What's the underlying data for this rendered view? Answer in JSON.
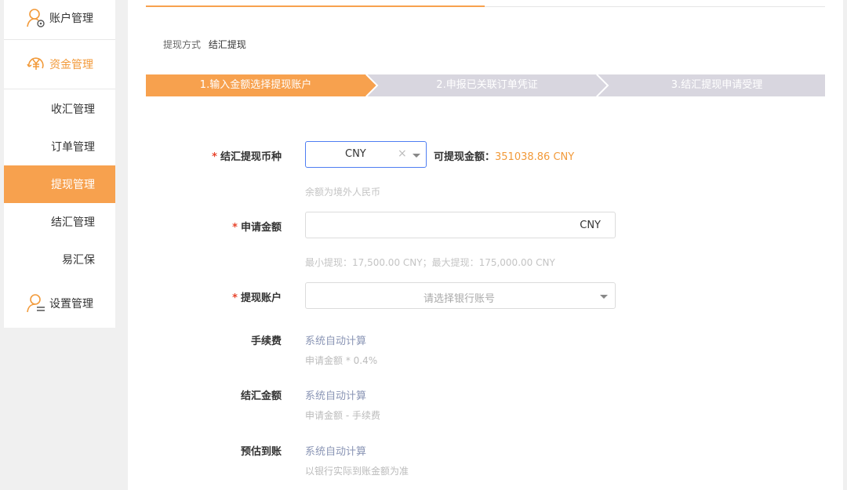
{
  "sidebar": {
    "account_label": "账户管理",
    "funds_label": "资金管理",
    "settings_label": "设置管理",
    "items": [
      {
        "label": "收汇管理"
      },
      {
        "label": "订单管理"
      },
      {
        "label": "提现管理"
      },
      {
        "label": "结汇管理"
      },
      {
        "label": "易汇保"
      }
    ],
    "active_index": 2
  },
  "breadcrumb": {
    "prefix": "提现方式",
    "current": "结汇提现"
  },
  "steps": [
    {
      "label": "1.输入金额选择提现账户",
      "state": "active"
    },
    {
      "label": "2.申报已关联订单凭证",
      "state": "pending"
    },
    {
      "label": "3.结汇提现申请受理",
      "state": "pending"
    }
  ],
  "form": {
    "currency": {
      "label": "结汇提现币种",
      "value": "CNY",
      "clear": "×",
      "available_label": "可提现金额：",
      "available_value": "351038.86 CNY",
      "hint": "余额为境外人民币"
    },
    "amount": {
      "label": "申请金额",
      "value": "",
      "suffix": "CNY",
      "hint": "最小提现：17,500.00 CNY；最大提现：175,000.00 CNY"
    },
    "account": {
      "label": "提现账户",
      "placeholder": "请选择银行账号"
    },
    "fee": {
      "label": "手续费",
      "value": "系统自动计算",
      "note": "申请金额 * 0.4%"
    },
    "settle": {
      "label": "结汇金额",
      "value": "系统自动计算",
      "note": "申请金额 - 手续费"
    },
    "estimate": {
      "label": "预估到账",
      "value": "系统自动计算",
      "note": "以银行实际到账金额为准"
    }
  },
  "colors": {
    "accent": "#f7a14e",
    "required": "#e8452c",
    "link_grey": "#8a95b5"
  }
}
